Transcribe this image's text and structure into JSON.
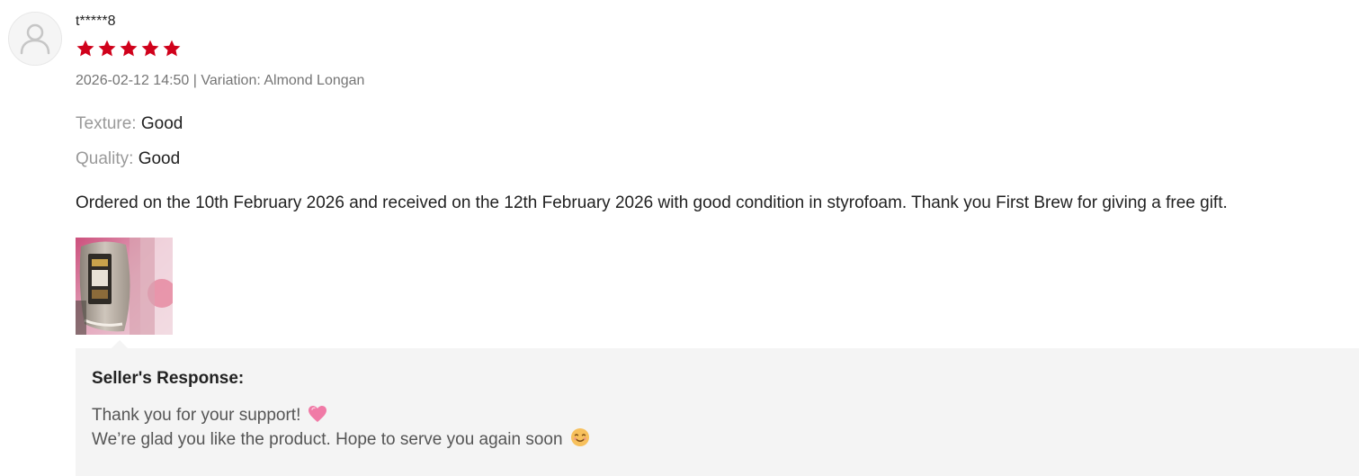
{
  "review": {
    "username": "t*****8",
    "rating": 5,
    "rating_max": 5,
    "star_color": "#d0011b",
    "date": "2026-02-12 14:50",
    "separator": " | ",
    "variation_label": "Variation: ",
    "variation_value": "Almond Longan",
    "attributes": [
      {
        "label": "Texture:",
        "value": "Good"
      },
      {
        "label": "Quality:",
        "value": "Good"
      }
    ],
    "text": "Ordered on the 10th February 2026 and received on the 12th February 2026 with good condition in styrofoam. Thank you First Brew for giving a free gift.",
    "photo_icon": "product-photo-thumbnail"
  },
  "seller_response": {
    "title": "Seller's Response:",
    "line1": "Thank you for your support!",
    "line1_emoji": "pink-heart-emoji",
    "line2": "We’re glad you like the product. Hope to serve you again soon",
    "line2_emoji": "smiling-face-emoji"
  },
  "icons": {
    "avatar": "default-user-icon",
    "star": "star-icon"
  }
}
